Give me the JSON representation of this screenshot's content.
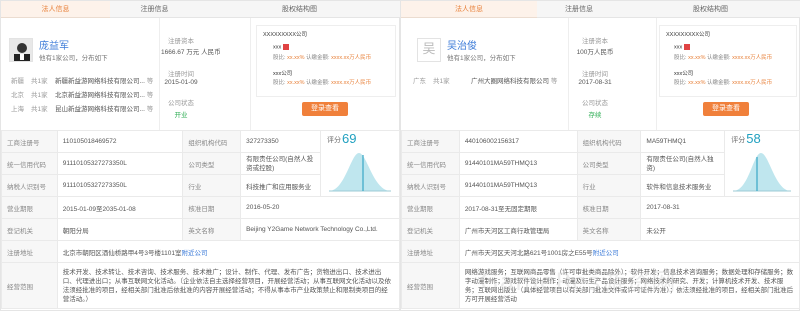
{
  "left": {
    "headers": {
      "rep": "法人信息",
      "reg": "注册信息",
      "eq": "股权结构图"
    },
    "rep": {
      "name": "庞益军",
      "sub": "他有1家公司，分布如下",
      "assoc": [
        {
          "loc": "新疆",
          "cnt": "共1家",
          "co": "新疆新益游网络科技有限公司...",
          "more": "等"
        },
        {
          "loc": "北京",
          "cnt": "共1家",
          "co": "北京新益游网络科技有限公司...",
          "more": "等"
        },
        {
          "loc": "上海",
          "cnt": "共1家",
          "co": "昆山新益游网络科技有限公司...",
          "more": "等"
        }
      ]
    },
    "reg": {
      "capital_label": "注册资本",
      "capital_value": "1666.67 万元 人民币",
      "date_label": "注册时间",
      "date_value": "2015-01-09",
      "status_label": "公司状态",
      "status_value": "开业"
    },
    "equity": {
      "top": "XXXXXXXXX公司",
      "r1": "xxx",
      "r1sub_a": "股比:",
      "r1sub_b": "xx.xx%",
      "r1sub_c": "认缴金额:",
      "r1sub_d": "xxxx.xx万人民币",
      "r2": "xxx公司",
      "r2sub_a": "股比:",
      "r2sub_b": "xx.xx%",
      "r2sub_c": "认缴金额:",
      "r2sub_d": "xxxx.xx万人民币",
      "btn": "登录查看"
    },
    "table": {
      "r1": [
        "工商注册号",
        "110105018469572",
        "组织机构代码",
        "327273350"
      ],
      "r2": [
        "统一信用代码",
        "91110105327273350L",
        "公司类型",
        "有限责任公司(自然人投资或控股)"
      ],
      "r3": [
        "纳税人识别号",
        "91110105327273350L",
        "行业",
        "科技推广和应用服务业"
      ],
      "r4": [
        "营业期限",
        "2015-01-09至2035-01-08",
        "核准日期",
        "2016-05-20"
      ],
      "r5": [
        "登记机关",
        "朝阳分局",
        "英文名称",
        "Beijing Y2Game Network Technology Co.,Ltd."
      ],
      "addr_k": "注册地址",
      "addr_v": "北京市朝阳区酒仙桥路甲4号3号楼1101室",
      "addr_link": "附近公司",
      "scope_k": "经营范围",
      "scope_v": "技术开发、技术转让、技术咨询、技术服务、技术推广；设计、制作、代理、发布广告；货物进出口、技术进出口、代理进出口；从事互联网文化活动。（企业依法自主选择经营项目，开展经营活动；从事互联网文化活动以及依法须经批准的项目，经相关部门批准后依批准的内容开展经营活动；不得从事本市产业政策禁止和限制类项目的经营活动。）",
      "score_label": "评分",
      "score": "69"
    }
  },
  "right": {
    "headers": {
      "rep": "法人信息",
      "reg": "注册信息",
      "eq": "股权结构图"
    },
    "rep": {
      "avatar_char": "吴",
      "name": "吴治俊",
      "sub": "他有1家公司，分布如下",
      "assoc": [
        {
          "loc": "广东",
          "cnt": "共1家",
          "co": "广州大圈网络科技有限公司",
          "more": "等"
        }
      ]
    },
    "reg": {
      "capital_label": "注册资本",
      "capital_value": "100万人民币",
      "date_label": "注册时间",
      "date_value": "2017-08-31",
      "status_label": "公司状态",
      "status_value": "存续"
    },
    "equity": {
      "top": "XXXXXXXXX公司",
      "r1": "xxx",
      "r1sub_a": "股比:",
      "r1sub_b": "xx.xx%",
      "r1sub_c": "认缴金额:",
      "r1sub_d": "xxxx.xx万人民币",
      "r2": "xxx公司",
      "r2sub_a": "股比:",
      "r2sub_b": "xx.xx%",
      "r2sub_c": "认缴金额:",
      "r2sub_d": "xxxx.xx万人民币",
      "btn": "登录查看"
    },
    "table": {
      "r1": [
        "工商注册号",
        "440106002156317",
        "组织机构代码",
        "MA59THMQ1"
      ],
      "r2": [
        "统一信用代码",
        "91440101MA59THMQ13",
        "公司类型",
        "有限责任公司(自然人独资)"
      ],
      "r3": [
        "纳税人识别号",
        "91440101MA59THMQ13",
        "行业",
        "软件和信息技术服务业"
      ],
      "r4": [
        "营业期限",
        "2017-08-31至无固定期限",
        "核准日期",
        "2017-08-31"
      ],
      "r5": [
        "登记机关",
        "广州市天河区工商行政管理局",
        "英文名称",
        "未公开"
      ],
      "addr_k": "注册地址",
      "addr_v": "广州市天河区天河北路621号1001房之E55号",
      "addr_link": "附近公司",
      "scope_k": "经营范围",
      "scope_v": "网络游戏服务；互联网商品零售（许可审批类商品除外）；软件开发；信息技术咨询服务；数据处理和存储服务；数字动漫制作；游戏软件设计制作；动漫及衍生产品设计服务；网络技术的研究、开发；计算机技术开发、技术服务；互联网出版业（具体经营项目以有关部门批准文件或许可证件为准）；依法须经批准的项目，经相关部门批准后方可开展经营活动",
      "score_label": "评分",
      "score": "58"
    }
  },
  "watermark": "GameRes游资网"
}
